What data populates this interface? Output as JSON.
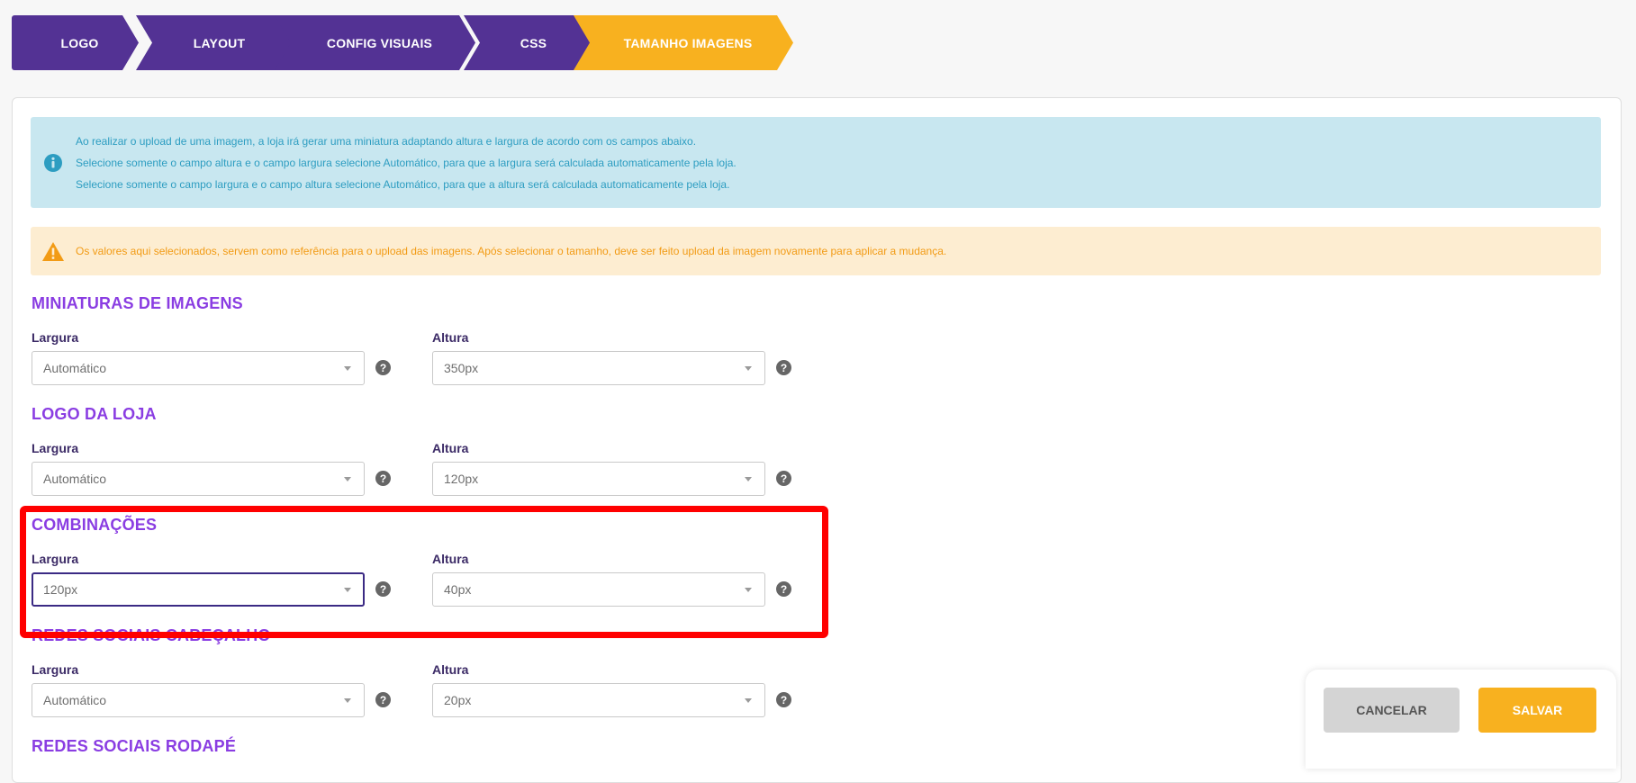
{
  "steps": [
    {
      "label": "LOGO",
      "active": false
    },
    {
      "label": "LAYOUT",
      "active": false
    },
    {
      "label": "CONFIG VISUAIS",
      "active": false
    },
    {
      "label": "CSS",
      "active": false
    },
    {
      "label": "TAMANHO IMAGENS",
      "active": true
    }
  ],
  "info_alert": {
    "lines": [
      "Ao realizar o upload de uma imagem, a loja irá gerar uma miniatura adaptando altura e largura de acordo com os campos abaixo.",
      "Selecione somente o campo altura e o campo largura selecione Automático, para que a largura será calculada automaticamente pela loja.",
      "Selecione somente o campo largura e o campo altura selecione Automático, para que a altura será calculada automaticamente pela loja."
    ]
  },
  "warning_alert": {
    "text": "Os valores aqui selecionados, servem como referência para o upload das imagens. Após selecionar o tamanho, deve ser feito upload da imagem novamente para aplicar a mudança."
  },
  "sections": [
    {
      "title": "MINIATURAS DE IMAGENS",
      "width_label": "Largura",
      "width_value": "Automático",
      "height_label": "Altura",
      "height_value": "350px"
    },
    {
      "title": "LOGO DA LOJA",
      "width_label": "Largura",
      "width_value": "Automático",
      "height_label": "Altura",
      "height_value": "120px"
    },
    {
      "title": "COMBINAÇÕES",
      "width_label": "Largura",
      "width_value": "120px",
      "height_label": "Altura",
      "height_value": "40px"
    },
    {
      "title": "REDES SOCIAIS CABEÇALHO",
      "width_label": "Largura",
      "width_value": "Automático",
      "height_label": "Altura",
      "height_value": "20px"
    },
    {
      "title": "REDES SOCIAIS RODAPÉ"
    }
  ],
  "help_glyph": "?",
  "buttons": {
    "cancel": "CANCELAR",
    "save": "SALVAR"
  },
  "colors": {
    "step_purple": "#533294",
    "step_active": "#f8b11f",
    "section_title": "#8a3de2",
    "info_bg": "#c8e7f0",
    "warning_bg": "#fdedd1",
    "highlight_border": "#ff0000"
  },
  "icons": {
    "info": "info-circle-icon",
    "warning": "warning-triangle-icon",
    "help": "question-circle-icon",
    "dropdown": "chevron-down-icon"
  }
}
